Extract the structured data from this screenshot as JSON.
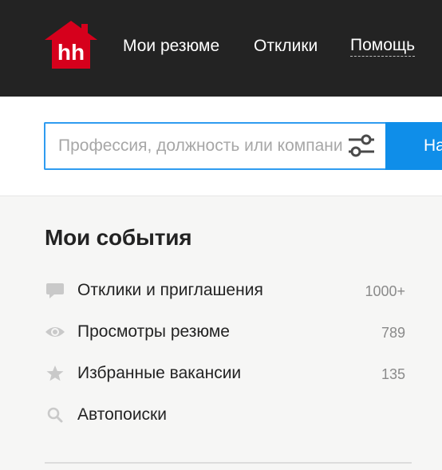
{
  "header": {
    "logo_text": "hh",
    "brand_color": "#d6001c",
    "background": "#232323",
    "nav": [
      {
        "label": "Мои резюме"
      },
      {
        "label": "Отклики"
      },
      {
        "label": "Помощь"
      }
    ]
  },
  "search": {
    "placeholder": "Профессия, должность или компания",
    "value": "",
    "button_label": "Найти",
    "accent_color": "#0f8ee9",
    "filter_icon": "sliders-icon"
  },
  "events": {
    "title": "Мои события",
    "items": [
      {
        "icon": "speech-bubble-icon",
        "label": "Отклики и приглашения",
        "count": "1000+"
      },
      {
        "icon": "eye-icon",
        "label": "Просмотры резюме",
        "count": "789"
      },
      {
        "icon": "star-icon",
        "label": "Избранные вакансии",
        "count": "135"
      },
      {
        "icon": "magnifier-icon",
        "label": "Автопоиски",
        "count": ""
      }
    ]
  }
}
